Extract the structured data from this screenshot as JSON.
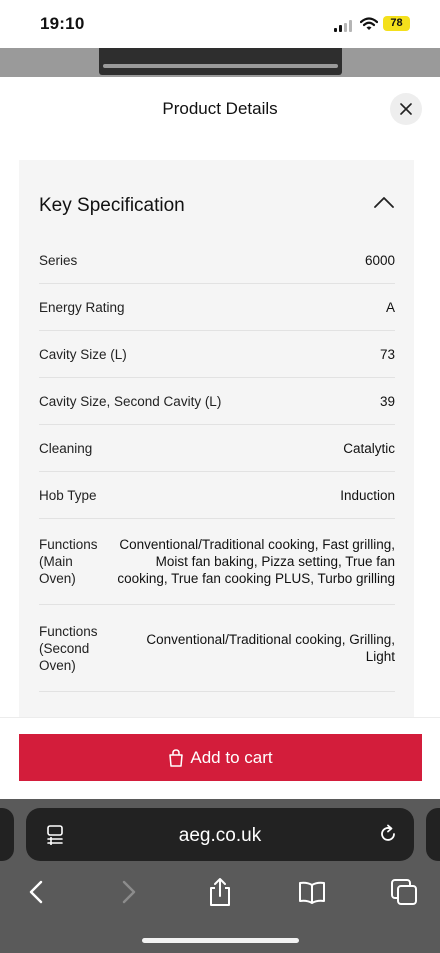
{
  "status_bar": {
    "time": "19:10",
    "battery": "78",
    "battery_color": "#f4e01c"
  },
  "sheet": {
    "title": "Product Details",
    "close_icon": "close-icon"
  },
  "spec": {
    "heading": "Key Specification",
    "collapse_icon": "chevron-up-icon",
    "rows": [
      {
        "label": "Series",
        "value": "6000"
      },
      {
        "label": "Energy Rating",
        "value": "A"
      },
      {
        "label": "Cavity Size (L)",
        "value": "73"
      },
      {
        "label": "Cavity Size, Second Cavity (L)",
        "value": "39"
      },
      {
        "label": "Cleaning",
        "value": "Catalytic"
      },
      {
        "label": "Hob Type",
        "value": "Induction"
      },
      {
        "label": "Functions (Main Oven)",
        "value": "Conventional/Traditional cooking, Fast grilling, Moist fan baking, Pizza setting, True fan cooking, True fan cooking PLUS, Turbo grilling"
      },
      {
        "label": "Functions (Second Oven)",
        "value": "Conventional/Traditional cooking, Grilling, Light"
      }
    ]
  },
  "cart": {
    "label": "Add to cart",
    "color": "#d31d3b",
    "icon": "shopping-bag-icon"
  },
  "browser": {
    "url": "aeg.co.uk",
    "icons": [
      "reader-icon",
      "reload-icon",
      "back-icon",
      "forward-icon",
      "share-icon",
      "bookmarks-icon",
      "tabs-icon"
    ]
  }
}
